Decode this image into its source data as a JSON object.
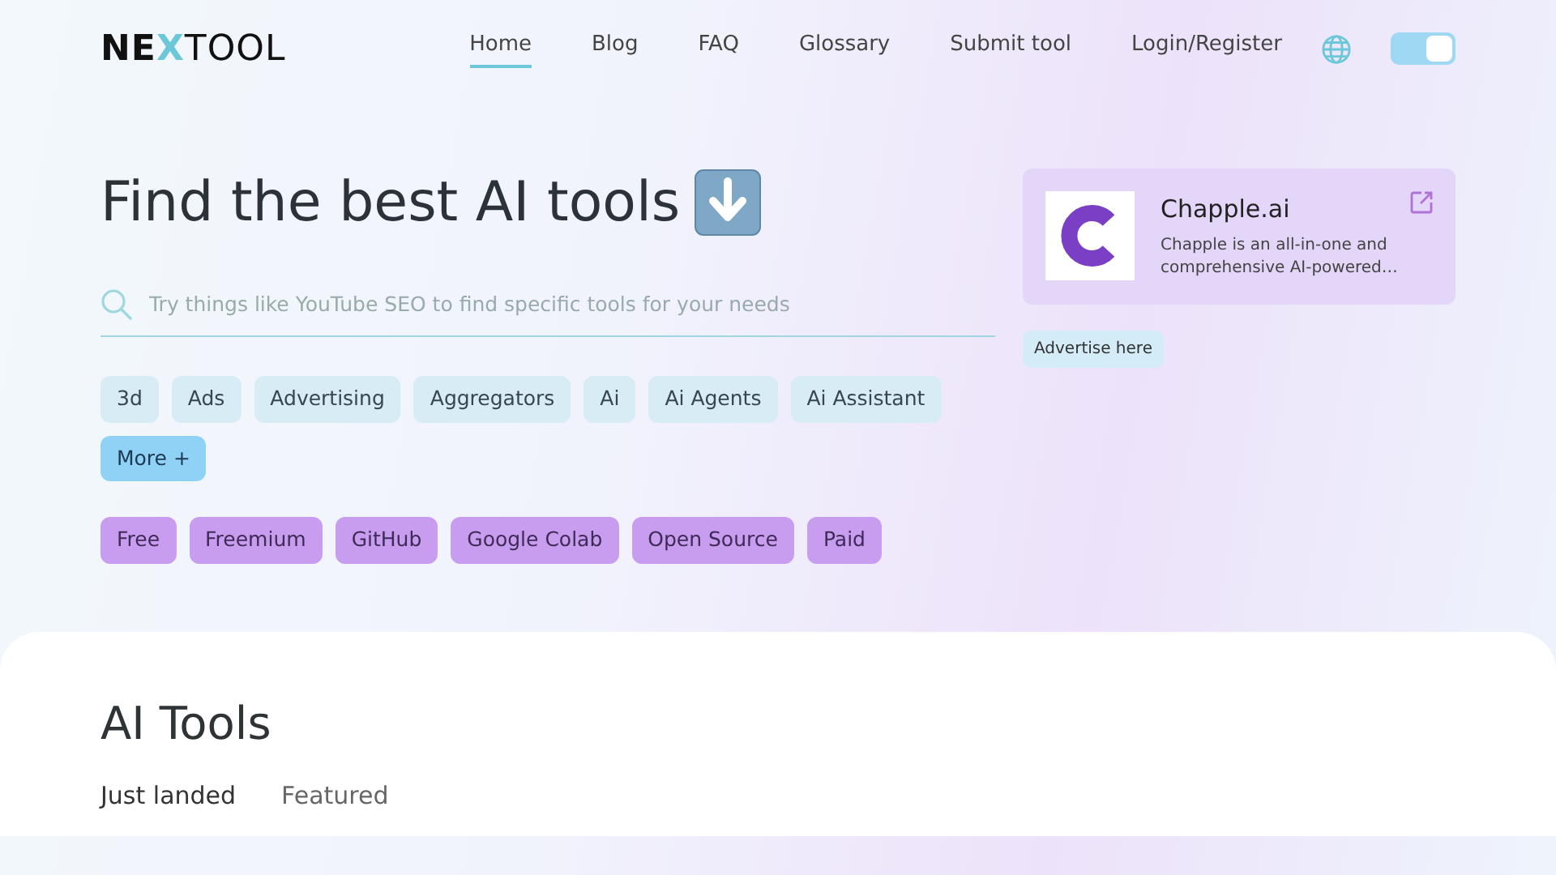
{
  "logo": {
    "text": "NEXTOOL"
  },
  "nav": [
    {
      "label": "Home",
      "selected": true
    },
    {
      "label": "Blog",
      "selected": false
    },
    {
      "label": "FAQ",
      "selected": false
    },
    {
      "label": "Glossary",
      "selected": false
    },
    {
      "label": "Submit tool",
      "selected": false
    },
    {
      "label": "Login/Register",
      "selected": false
    }
  ],
  "theme_toggle": {
    "on": true
  },
  "hero": {
    "title": "Find the best AI tools",
    "search": {
      "placeholder": "Try things like YouTube SEO to find specific tools for your needs"
    }
  },
  "categories": [
    "3d",
    "Ads",
    "Advertising",
    "Aggregators",
    "Ai",
    "Ai Agents",
    "Ai Assistant"
  ],
  "more_button": "More +",
  "pricing": [
    "Free",
    "Freemium",
    "GitHub",
    "Google Colab",
    "Open Source",
    "Paid"
  ],
  "ad": {
    "name": "Chapple.ai",
    "description": "Chapple is an all-in-one and comprehensive AI-powered…",
    "advertise": "Advertise here"
  },
  "section": {
    "title": "AI Tools",
    "tabs": [
      {
        "label": "Just landed",
        "selected": true
      },
      {
        "label": "Featured",
        "selected": false
      }
    ]
  }
}
